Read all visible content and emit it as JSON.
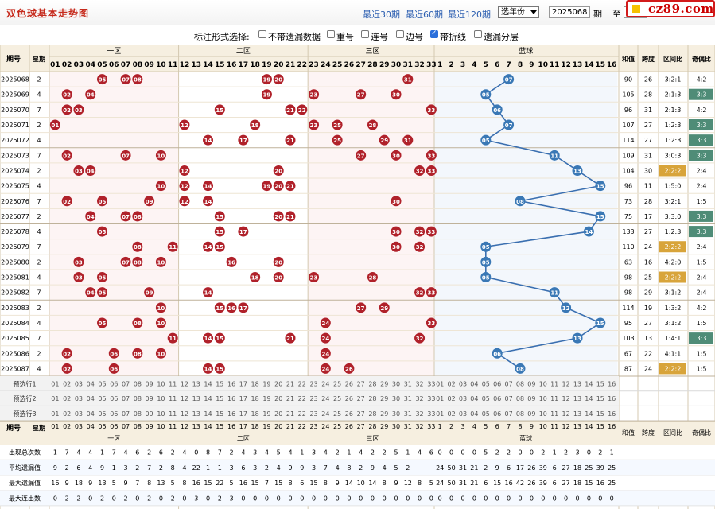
{
  "header": {
    "title": "双色球基本走势图",
    "links": [
      "最近30期",
      "最近60期",
      "最近120期"
    ],
    "year_select": "选年份",
    "from_issue": "2025068",
    "label_qi": "期",
    "label_zhi": "至",
    "to_issue": "2",
    "logo": "cz89.com"
  },
  "options": {
    "label": "标注形式选择:",
    "items": [
      {
        "label": "不带遗漏数据",
        "checked": false
      },
      {
        "label": "重号",
        "checked": false
      },
      {
        "label": "连号",
        "checked": false
      },
      {
        "label": "边号",
        "checked": false
      },
      {
        "label": "带折线",
        "checked": true
      },
      {
        "label": "遗漏分层",
        "checked": false
      }
    ]
  },
  "table": {
    "hdr_issue": "期号",
    "hdr_week": "星期",
    "zones": [
      "一区",
      "二区",
      "三区",
      "蓝球"
    ],
    "stat_headers": [
      "和值",
      "跨度",
      "区间比",
      "奇偶比"
    ],
    "red_numbers": [
      "01",
      "02",
      "03",
      "04",
      "05",
      "06",
      "07",
      "08",
      "09",
      "10",
      "11",
      "12",
      "13",
      "14",
      "15",
      "16",
      "17",
      "18",
      "19",
      "20",
      "21",
      "22",
      "23",
      "24",
      "25",
      "26",
      "27",
      "28",
      "29",
      "30",
      "31",
      "32",
      "33"
    ],
    "blue_numbers": [
      "01",
      "02",
      "03",
      "04",
      "05",
      "06",
      "07",
      "08",
      "09",
      "10",
      "11",
      "12",
      "13",
      "14",
      "15",
      "16"
    ],
    "blue_numbers_plain": [
      "1",
      "2",
      "3",
      "4",
      "5",
      "6",
      "7",
      "8",
      "9",
      "10",
      "11",
      "12",
      "13",
      "14",
      "15",
      "16"
    ],
    "rows": [
      {
        "issue": "2025068",
        "week": "2",
        "reds": [
          5,
          7,
          8,
          19,
          20,
          31
        ],
        "blue": 7,
        "sum": "90",
        "span": "26",
        "zone": "3:2:1",
        "oe": "4:2"
      },
      {
        "issue": "2025069",
        "week": "4",
        "reds": [
          2,
          4,
          19,
          23,
          27,
          30
        ],
        "blue": 5,
        "sum": "105",
        "span": "28",
        "zone": "2:1:3",
        "oe": "3:3"
      },
      {
        "issue": "2025070",
        "week": "7",
        "reds": [
          2,
          3,
          15,
          21,
          22,
          33
        ],
        "blue": 6,
        "sum": "96",
        "span": "31",
        "zone": "2:1:3",
        "oe": "4:2"
      },
      {
        "issue": "2025071",
        "week": "2",
        "reds": [
          1,
          12,
          18,
          23,
          25,
          28
        ],
        "blue": 7,
        "sum": "107",
        "span": "27",
        "zone": "1:2:3",
        "oe": "3:3"
      },
      {
        "issue": "2025072",
        "week": "4",
        "reds": [
          14,
          17,
          21,
          25,
          29,
          31
        ],
        "blue": 5,
        "sum": "114",
        "span": "27",
        "zone": "1:2:3",
        "oe": "3:3"
      },
      {
        "issue": "2025073",
        "week": "7",
        "reds": [
          2,
          7,
          10,
          27,
          30,
          33
        ],
        "blue": 11,
        "sum": "109",
        "span": "31",
        "zone": "3:0:3",
        "oe": "3:3"
      },
      {
        "issue": "2025074",
        "week": "2",
        "reds": [
          3,
          4,
          12,
          20,
          32,
          33
        ],
        "blue": 13,
        "sum": "104",
        "span": "30",
        "zone": "2:2:2",
        "oe": "2:4"
      },
      {
        "issue": "2025075",
        "week": "4",
        "reds": [
          10,
          12,
          14,
          19,
          20,
          21
        ],
        "blue": 15,
        "sum": "96",
        "span": "11",
        "zone": "1:5:0",
        "oe": "2:4"
      },
      {
        "issue": "2025076",
        "week": "7",
        "reds": [
          2,
          5,
          9,
          12,
          14,
          30
        ],
        "blue": 8,
        "sum": "73",
        "span": "28",
        "zone": "3:2:1",
        "oe": "1:5"
      },
      {
        "issue": "2025077",
        "week": "2",
        "reds": [
          4,
          7,
          8,
          15,
          20,
          21
        ],
        "blue": 15,
        "sum": "75",
        "span": "17",
        "zone": "3:3:0",
        "oe": "3:3"
      },
      {
        "issue": "2025078",
        "week": "4",
        "reds": [
          5,
          15,
          17,
          30,
          32,
          33
        ],
        "blue": 14,
        "sum": "133",
        "span": "27",
        "zone": "1:2:3",
        "oe": "3:3"
      },
      {
        "issue": "2025079",
        "week": "7",
        "reds": [
          8,
          11,
          14,
          15,
          30,
          32
        ],
        "blue": 5,
        "sum": "110",
        "span": "24",
        "zone": "2:2:2",
        "oe": "2:4"
      },
      {
        "issue": "2025080",
        "week": "2",
        "reds": [
          3,
          7,
          8,
          10,
          16,
          20
        ],
        "blue": 5,
        "sum": "63",
        "span": "16",
        "zone": "4:2:0",
        "oe": "1:5"
      },
      {
        "issue": "2025081",
        "week": "4",
        "reds": [
          3,
          5,
          18,
          20,
          23,
          28
        ],
        "blue": 5,
        "sum": "98",
        "span": "25",
        "zone": "2:2:2",
        "oe": "2:4"
      },
      {
        "issue": "2025082",
        "week": "7",
        "reds": [
          4,
          5,
          9,
          14,
          32,
          33
        ],
        "blue": 11,
        "sum": "98",
        "span": "29",
        "zone": "3:1:2",
        "oe": "2:4"
      },
      {
        "issue": "2025083",
        "week": "2",
        "reds": [
          10,
          15,
          16,
          17,
          27,
          29
        ],
        "blue": 12,
        "sum": "114",
        "span": "19",
        "zone": "1:3:2",
        "oe": "4:2"
      },
      {
        "issue": "2025084",
        "week": "4",
        "reds": [
          5,
          8,
          10,
          24,
          33
        ],
        "blue": 15,
        "sum": "95",
        "span": "27",
        "zone": "3:1:2",
        "oe": "1:5"
      },
      {
        "issue": "2025085",
        "week": "7",
        "reds": [
          11,
          14,
          15,
          21,
          24,
          32
        ],
        "blue": 13,
        "sum": "103",
        "span": "13",
        "zone": "1:4:1",
        "oe": "3:3"
      },
      {
        "issue": "2025086",
        "week": "2",
        "reds": [
          2,
          6,
          8,
          10,
          24
        ],
        "blue": 6,
        "sum": "67",
        "span": "22",
        "zone": "4:1:1",
        "oe": "1:5"
      },
      {
        "issue": "2025087",
        "week": "4",
        "reds": [
          2,
          6,
          14,
          15,
          24,
          26
        ],
        "blue": 8,
        "sum": "87",
        "span": "24",
        "zone": "2:2:2",
        "oe": "1:5"
      }
    ],
    "preselect_labels": [
      "预选行1",
      "预选行2",
      "预选行3"
    ],
    "stats_rows": [
      {
        "label": "出现总次数",
        "reds": [
          "1",
          "7",
          "4",
          "4",
          "1",
          "7",
          "4",
          "6",
          "2",
          "6",
          "2",
          "4",
          "0",
          "8",
          "7",
          "2",
          "4",
          "3",
          "4",
          "5",
          "4",
          "1",
          "3",
          "4",
          "2",
          "1",
          "4",
          "2",
          "2",
          "5",
          "1",
          "4",
          "6"
        ],
        "blues": [
          "0",
          "0",
          "0",
          "0",
          "5",
          "2",
          "2",
          "0",
          "0",
          "2",
          "1",
          "2",
          "3",
          "0",
          "2",
          "1"
        ]
      },
      {
        "label": "平均遗漏值",
        "reds": [
          "9",
          "2",
          "6",
          "4",
          "9",
          "1",
          "3",
          "2",
          "7",
          "2",
          "8",
          "4",
          "22",
          "1",
          "1",
          "3",
          "6",
          "3",
          "2",
          "4",
          "9",
          "9",
          "3",
          "7",
          "4",
          "8",
          "2",
          "9",
          "4",
          "5",
          "2"
        ],
        "blues": [
          "24",
          "50",
          "31",
          "21",
          "2",
          "9",
          "6",
          "17",
          "26",
          "39",
          "6",
          "27",
          "18",
          "25",
          "39",
          "25"
        ]
      },
      {
        "label": "最大遗漏值",
        "reds": [
          "16",
          "9",
          "18",
          "9",
          "13",
          "5",
          "9",
          "7",
          "8",
          "13",
          "5",
          "8",
          "16",
          "15",
          "22",
          "5",
          "16",
          "15",
          "7",
          "15",
          "8",
          "6",
          "15",
          "8",
          "9",
          "14",
          "10",
          "14",
          "8",
          "9",
          "12",
          "8",
          "5"
        ],
        "blues": [
          "24",
          "50",
          "31",
          "21",
          "6",
          "15",
          "16",
          "42",
          "26",
          "39",
          "6",
          "27",
          "18",
          "15",
          "16",
          "25"
        ]
      },
      {
        "label": "最大连出数",
        "reds": [
          "0",
          "2",
          "2",
          "0",
          "2",
          "0",
          "2",
          "0",
          "2",
          "0",
          "2",
          "0",
          "3",
          "0",
          "2",
          "3",
          "0",
          "0",
          "0",
          "0",
          "0",
          "0",
          "0",
          "0",
          "0",
          "0",
          "0",
          "0",
          "0",
          "0",
          "0",
          "0",
          "0"
        ],
        "blues": [
          "0",
          "0",
          "0",
          "0",
          "0",
          "0",
          "0",
          "0",
          "0",
          "0",
          "0",
          "0",
          "0",
          "0",
          "0",
          "0"
        ]
      }
    ]
  },
  "colors": {
    "red_ball": "#b0212a",
    "blue_ball": "#3a78b5",
    "line": "#3a6fb0",
    "stat_green": "#4f8c77",
    "stat_gold": "#d8a43a"
  }
}
